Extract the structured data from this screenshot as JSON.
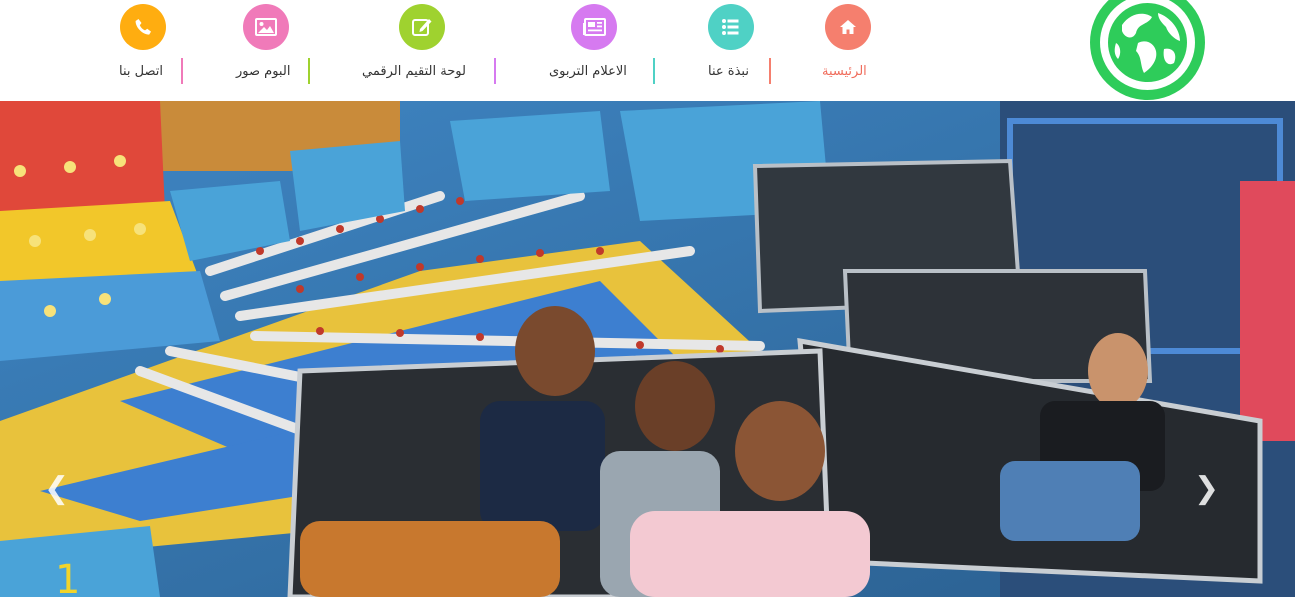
{
  "nav": {
    "items": [
      {
        "label": "الرئيسية",
        "icon": "home-icon",
        "color": "#f57f6e",
        "active": true
      },
      {
        "label": "نبذة عنا",
        "icon": "list-icon",
        "color": "#4fd1c5",
        "active": false
      },
      {
        "label": "الاعلام التربوى",
        "icon": "newspaper-icon",
        "color": "#d67af0",
        "active": false
      },
      {
        "label": "لوحة التقيم الرقمي",
        "icon": "edit-icon",
        "color": "#9fd22f",
        "active": false
      },
      {
        "label": "البوم صور",
        "icon": "image-icon",
        "color": "#f07ab9",
        "active": false
      },
      {
        "label": "اتصل بنا",
        "icon": "phone-icon",
        "color": "#ffad10",
        "active": false
      }
    ]
  },
  "logo": {
    "icon": "globe-logo",
    "color": "#2ecc5a"
  },
  "slider": {
    "image": "children-on-amusement-ride-photo",
    "prev_icon": "chevron-left-icon",
    "next_icon": "chevron-right-icon"
  }
}
